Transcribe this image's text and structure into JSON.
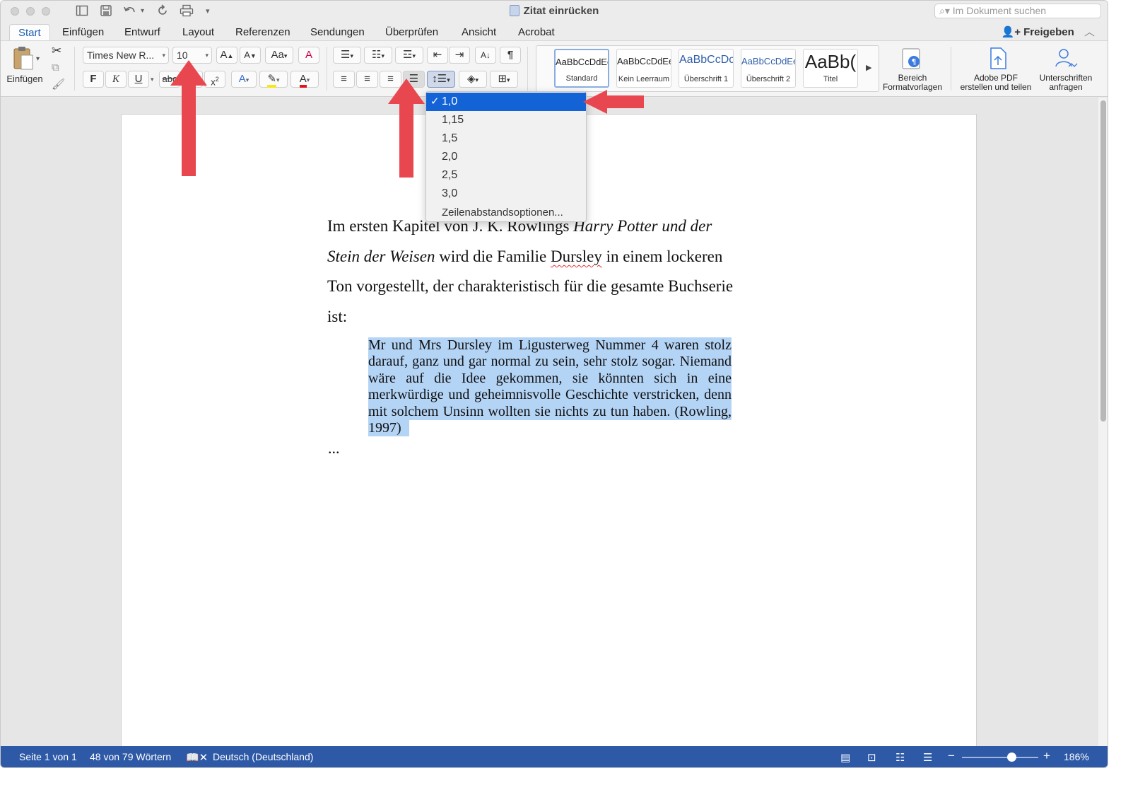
{
  "window": {
    "title": "Zitat einrücken",
    "search_placeholder": "Im Dokument suchen",
    "share_label": "Freigeben"
  },
  "tabs": [
    "Start",
    "Einfügen",
    "Entwurf",
    "Layout",
    "Referenzen",
    "Sendungen",
    "Überprüfen",
    "Ansicht",
    "Acrobat"
  ],
  "ribbon": {
    "paste_label": "Einfügen",
    "font_name": "Times New R...",
    "font_size": "10",
    "bold": "F",
    "italic": "K",
    "underline": "U",
    "strike": "abc",
    "styles": [
      {
        "sample": "AaBbCcDdEe",
        "caption": "Standard",
        "color": "#222222"
      },
      {
        "sample": "AaBbCcDdEe",
        "caption": "Kein Leerraum",
        "color": "#222222"
      },
      {
        "sample": "AaBbCcDc",
        "caption": "Überschrift 1",
        "color": "#2e5fa8"
      },
      {
        "sample": "AaBbCcDdEe",
        "caption": "Überschrift 2",
        "color": "#2e5fa8"
      },
      {
        "sample": "AaBb(",
        "caption": "Titel",
        "color": "#222222"
      }
    ],
    "pane_label_1": "Bereich",
    "pane_label_2": "Formatvorlagen",
    "pdf_label_1": "Adobe PDF",
    "pdf_label_2": "erstellen und teilen",
    "sign_label_1": "Unterschriften",
    "sign_label_2": "anfragen"
  },
  "line_spacing_menu": {
    "options": [
      "1,0",
      "1,15",
      "1,5",
      "2,0",
      "2,5",
      "3,0"
    ],
    "selected": "1,0",
    "more_options": "Zeilenabstandsoptionen..."
  },
  "document": {
    "line1_a": "Im ersten Kapitel von J. K. Rowlings ",
    "line1_b": "Harry Potter und der",
    "line2_a": "Stein der Weisen",
    "line2_b": " wird die Familie ",
    "line2_c": "Dursley",
    "line2_d": " in einem lockeren",
    "line3": "Ton vorgestellt, der charakteristisch für die gesamte Buchserie",
    "line4": "ist:",
    "quote_lines": [
      "Mr und Mrs Dursley im Ligusterweg Nummer 4 waren stolz",
      "darauf, ganz und gar normal zu sein, sehr stolz sogar. Niemand",
      "wäre auf die Idee gekommen, sie könnten sich in eine",
      "merkwürdige und geheimnisvolle Geschichte verstricken, denn",
      "mit solchem Unsinn wollten sie nichts zu tun haben. (Rowling,",
      "1997)"
    ],
    "ellipsis": "..."
  },
  "status": {
    "page": "Seite 1 von 1",
    "words": "48 von 79 Wörtern",
    "language": "Deutsch (Deutschland)",
    "zoom": "186%",
    "zoom_slider_level": 0.65
  },
  "colors": {
    "accent": "#1463d6",
    "statusbar": "#2d59a6",
    "selection": "#b4d4f6",
    "annotation_arrow": "#e8474f"
  }
}
